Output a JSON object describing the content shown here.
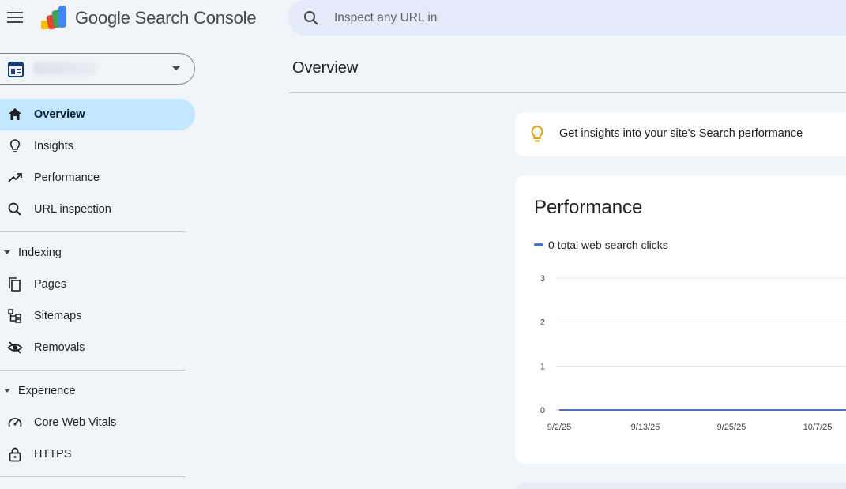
{
  "header": {
    "brand": "Google Search Console",
    "search_placeholder": "Inspect any URL in"
  },
  "nav": {
    "overview": "Overview",
    "insights": "Insights",
    "performance": "Performance",
    "url_inspection": "URL inspection",
    "indexing": "Indexing",
    "pages": "Pages",
    "sitemaps": "Sitemaps",
    "removals": "Removals",
    "experience": "Experience",
    "core_web_vitals": "Core Web Vitals",
    "https": "HTTPS"
  },
  "main": {
    "title": "Overview",
    "insight_text": "Get insights into your site's Search performance",
    "performance_title": "Performance",
    "legend": "0 total web search clicks"
  },
  "chart_data": {
    "type": "line",
    "series": [
      {
        "name": "total web search clicks",
        "x": [
          "9/2/25",
          "9/13/25",
          "9/25/25",
          "10/7/25"
        ],
        "values": [
          0,
          0,
          0,
          0
        ]
      }
    ],
    "x_ticks": [
      "9/2/25",
      "9/13/25",
      "9/25/25",
      "10/7/25"
    ],
    "y_ticks": [
      "0",
      "1",
      "2",
      "3"
    ],
    "ylim": [
      0,
      3
    ],
    "grid": true,
    "color": "#4e73b8"
  },
  "colors": {
    "active_nav": "#c2e7ff",
    "search_bg": "#e3eaf8",
    "page_bg": "#f1f4f9",
    "bulb": "#e3a008"
  }
}
